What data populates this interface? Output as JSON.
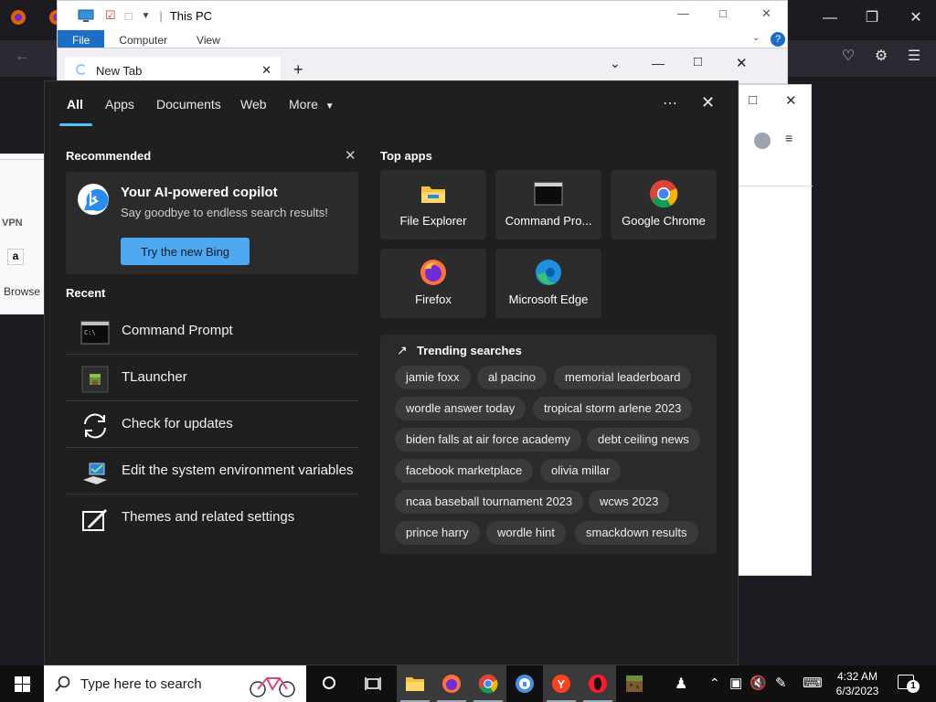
{
  "explorer": {
    "title": "This PC",
    "ribbon_tabs": [
      "File",
      "Computer",
      "View"
    ]
  },
  "browser": {
    "tab_title": "New Tab",
    "left_page_texts": [
      "VPN",
      "Browse"
    ]
  },
  "search_flyout": {
    "tabs": [
      "All",
      "Apps",
      "Documents",
      "Web",
      "More"
    ],
    "recommended_title": "Recommended",
    "bing_card": {
      "heading": "Your AI-powered copilot",
      "subtext": "Say goodbye to endless search results!",
      "button": "Try the new Bing"
    },
    "recent_title": "Recent",
    "recent_items": [
      {
        "label": "Command Prompt",
        "icon": "command-prompt-icon"
      },
      {
        "label": "TLauncher",
        "icon": "tlauncher-icon"
      },
      {
        "label": "Check for updates",
        "icon": "sync-icon"
      },
      {
        "label": "Edit the system environment variables",
        "icon": "system-properties-icon"
      },
      {
        "label": "Themes and related settings",
        "icon": "themes-icon"
      }
    ],
    "top_apps_title": "Top apps",
    "top_apps": [
      {
        "label": "File Explorer",
        "icon": "file-explorer-icon"
      },
      {
        "label": "Command Pro...",
        "icon": "command-prompt-icon"
      },
      {
        "label": "Google Chrome",
        "icon": "chrome-icon"
      },
      {
        "label": "Firefox",
        "icon": "firefox-icon"
      },
      {
        "label": "Microsoft Edge",
        "icon": "edge-icon"
      }
    ],
    "trending_title": "Trending searches",
    "trending": [
      "jamie foxx",
      "al pacino",
      "memorial leaderboard",
      "wordle answer today",
      "tropical storm arlene 2023",
      "biden falls at air force academy",
      "debt ceiling news",
      "facebook marketplace",
      "olivia millar",
      "ncaa baseball tournament 2023",
      "wcws 2023",
      "prince harry",
      "wordle hint",
      "smackdown results"
    ]
  },
  "taskbar": {
    "search_placeholder": "Type here to search",
    "time": "4:32 AM",
    "date": "6/3/2023",
    "notification_count": "1"
  },
  "colors": {
    "accent": "#4cc2ff",
    "bing_button": "#4fa9f0",
    "flyout_bg": "#1f1f1f",
    "taskbar_bg": "#101010"
  }
}
